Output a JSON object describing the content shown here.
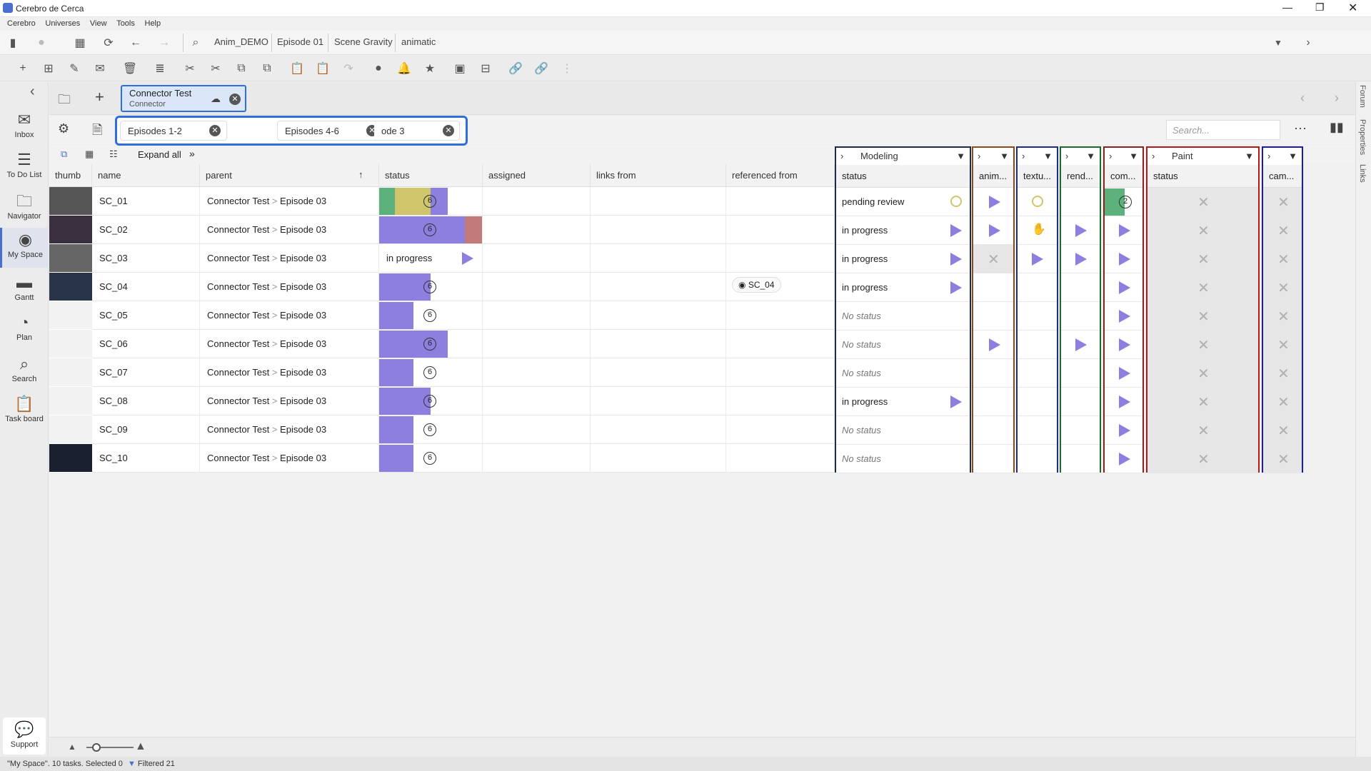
{
  "app": {
    "title": "Cerebro de Cerca"
  },
  "menu": [
    "Cerebro",
    "Universes",
    "View",
    "Tools",
    "Help"
  ],
  "breadcrumb": [
    "Anim_DEMO",
    "Episode 01",
    "Scene Gravity",
    "animatic"
  ],
  "sidebar": [
    {
      "label": "Inbox",
      "icon": "mail-icon"
    },
    {
      "label": "To Do List",
      "icon": "list-icon"
    },
    {
      "label": "Navigator",
      "icon": "folder-icon"
    },
    {
      "label": "My Space",
      "icon": "globe-icon"
    },
    {
      "label": "Gantt",
      "icon": "gantt-icon"
    },
    {
      "label": "Plan",
      "icon": "clock-icon"
    },
    {
      "label": "Search",
      "icon": "search-icon"
    },
    {
      "label": "Task board",
      "icon": "clipboard-icon"
    }
  ],
  "support": "Support",
  "project_tab": {
    "title": "Connector Test",
    "subtitle": "Connector"
  },
  "filters": [
    "Episodes 1-2",
    "Episodes 4-6",
    "ode 3"
  ],
  "search_placeholder": "Search...",
  "options": {
    "expand_all": "Expand all"
  },
  "columns": [
    "thumb",
    "name",
    "parent",
    "status",
    "assigned",
    "links from",
    "referenced from"
  ],
  "groups": [
    {
      "title": "Modeling",
      "sub": "status",
      "color": "#1f2a44"
    },
    {
      "title": "",
      "sub": "anim...",
      "color": "#8a4a1e"
    },
    {
      "title": "",
      "sub": "textu...",
      "color": "#1f2a8a"
    },
    {
      "title": "",
      "sub": "rend...",
      "color": "#1f6a2a"
    },
    {
      "title": "",
      "sub": "com...",
      "color": "#8a2020"
    },
    {
      "title": "Paint",
      "sub": "status",
      "color": "#b01a1a"
    },
    {
      "title": "",
      "sub": "cam...",
      "color": "#1a1ab0"
    }
  ],
  "parent_sep": ">",
  "rows": [
    {
      "name": "SC_01",
      "parent_a": "Connector Test",
      "parent_b": "Episode 03",
      "badge": "6",
      "modeling": "pending review",
      "ref": "",
      "comp_badge": "2"
    },
    {
      "name": "SC_02",
      "parent_a": "Connector Test",
      "parent_b": "Episode 03",
      "badge": "6",
      "modeling": "in progress",
      "ref": "",
      "comp_badge": ""
    },
    {
      "name": "SC_03",
      "parent_a": "Connector Test",
      "parent_b": "Episode 03",
      "badge": "",
      "status_text": "in progress",
      "modeling": "in progress",
      "ref": "",
      "comp_badge": ""
    },
    {
      "name": "SC_04",
      "parent_a": "Connector Test",
      "parent_b": "Episode 03",
      "badge": "6",
      "modeling": "in progress",
      "ref": "SC_04",
      "comp_badge": ""
    },
    {
      "name": "SC_05",
      "parent_a": "Connector Test",
      "parent_b": "Episode 03",
      "badge": "6",
      "modeling": "No status",
      "ref": "",
      "comp_badge": ""
    },
    {
      "name": "SC_06",
      "parent_a": "Connector Test",
      "parent_b": "Episode 03",
      "badge": "6",
      "modeling": "No status",
      "ref": "",
      "comp_badge": ""
    },
    {
      "name": "SC_07",
      "parent_a": "Connector Test",
      "parent_b": "Episode 03",
      "badge": "6",
      "modeling": "No status",
      "ref": "",
      "comp_badge": ""
    },
    {
      "name": "SC_08",
      "parent_a": "Connector Test",
      "parent_b": "Episode 03",
      "badge": "6",
      "modeling": "in progress",
      "ref": "",
      "comp_badge": ""
    },
    {
      "name": "SC_09",
      "parent_a": "Connector Test",
      "parent_b": "Episode 03",
      "badge": "6",
      "modeling": "No status",
      "ref": "",
      "comp_badge": ""
    },
    {
      "name": "SC_10",
      "parent_a": "Connector Test",
      "parent_b": "Episode 03",
      "badge": "6",
      "modeling": "No status",
      "ref": "",
      "comp_badge": ""
    }
  ],
  "right_strip": [
    "Forum",
    "Properties",
    "Links"
  ],
  "statusbar": "\"My Space\". 10 tasks. Selected 0",
  "statusbar_filter": "Filtered 21",
  "colors": {
    "accent": "#4a6fd0",
    "progress": "#8c7fe0",
    "green": "#5cb27a",
    "yellow": "#cfc56a",
    "red": "#c27a7a"
  }
}
